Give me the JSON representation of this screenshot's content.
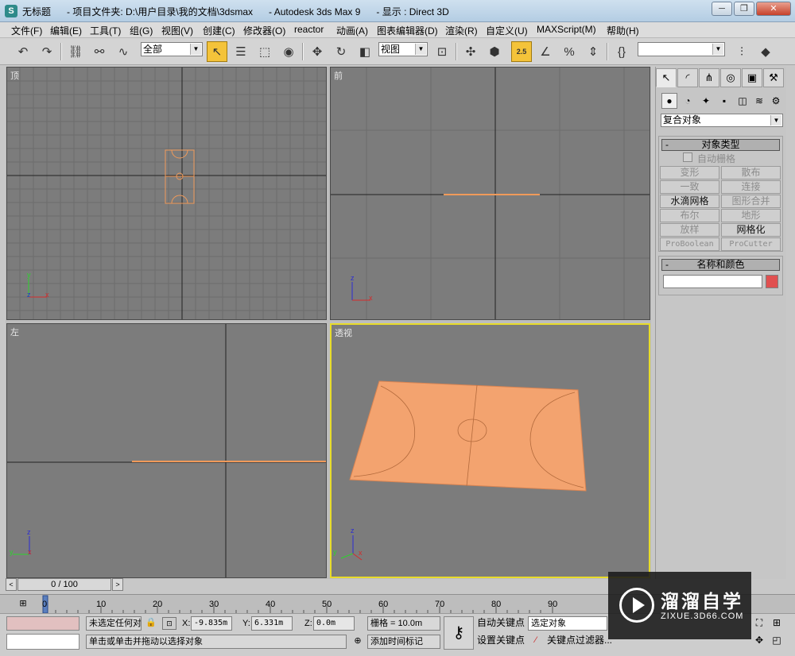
{
  "window": {
    "title": "无标题      - 项目文件夹: D:\\用户目录\\我的文档\\3dsmax      - Autodesk 3ds Max 9      - 显示 : Direct 3D",
    "minimize": "─",
    "restore": "❐",
    "close": "✕"
  },
  "menu": [
    "文件(F)",
    "编辑(E)",
    "工具(T)",
    "组(G)",
    "视图(V)",
    "创建(C)",
    "修改器(O)",
    "reactor",
    "动画(A)",
    "图表编辑器(D)",
    "渲染(R)",
    "自定义(U)",
    "MAXScript(M)",
    "帮助(H)"
  ],
  "toolbar": {
    "selection_filter": "全部",
    "ref_coord": "视图",
    "named_selection": "",
    "snap_value": "2.5"
  },
  "viewports": {
    "top": "顶",
    "front": "前",
    "left": "左",
    "perspective": "透视"
  },
  "axes": {
    "x": "x",
    "y": "y",
    "z": "z"
  },
  "command_panel": {
    "category": "复合对象",
    "object_type": {
      "title": "对象类型",
      "toggle": "-",
      "autogrid": "自动栅格",
      "buttons": [
        "变形",
        "散布",
        "一致",
        "连接",
        "水滴网格",
        "图形合并",
        "布尔",
        "地形",
        "放样",
        "网格化",
        "ProBoolean",
        "ProCutter"
      ]
    },
    "name_color": {
      "title": "名称和颜色",
      "toggle": "-",
      "name_value": "",
      "color": "#e05050"
    }
  },
  "timeline": {
    "frame": "0 / 100",
    "prev": "<",
    "next": ">",
    "ticks": [
      "0",
      "10",
      "20",
      "30",
      "40",
      "50",
      "60",
      "70",
      "80",
      "90"
    ]
  },
  "status": {
    "selection": "未选定任何对",
    "prompt": "单击或单击并拖动以选择对象",
    "x_label": "X:",
    "x_value": "-9.835m",
    "y_label": "Y:",
    "y_value": "6.331m",
    "z_label": "Z:",
    "z_value": "0.0m",
    "grid": "栅格 = 10.0m",
    "add_time_tag": "添加时间标记",
    "auto_key": "自动关键点",
    "set_key": "设置关键点",
    "key_mode": "选定对象",
    "key_filters": "关键点过滤器..."
  },
  "watermark": {
    "main": "溜溜自学",
    "sub": "ZIXUE.3D66.COM"
  },
  "colors": {
    "viewport_bg": "#7c7c7c",
    "object": "#f0a070",
    "active_border": "#e8dc2a",
    "active_tool": "#f4c33a"
  }
}
